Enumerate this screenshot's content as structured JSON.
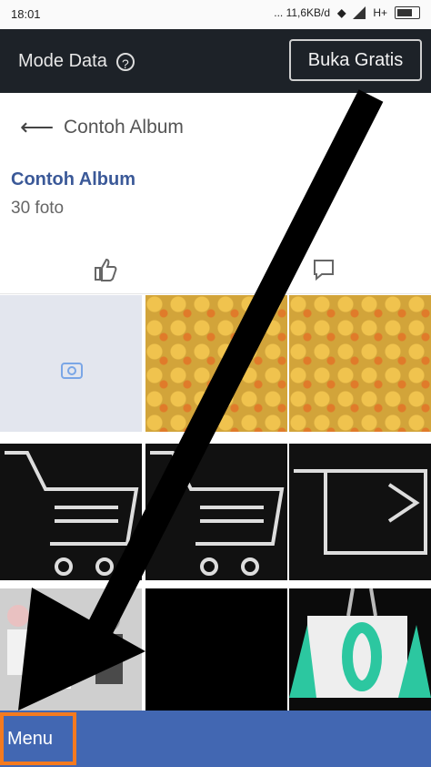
{
  "status_bar": {
    "time": "18:01",
    "network_speed": "... 11,6KB/d",
    "network_type": "H+"
  },
  "data_bar": {
    "mode_label": "Mode Data",
    "help_icon": "question-circle-icon",
    "free_button": "Buka Gratis"
  },
  "header": {
    "back_icon": "arrow-left-icon",
    "title": "Contoh Album"
  },
  "album": {
    "name": "Contoh Album",
    "count": "30 foto"
  },
  "actions": {
    "like_icon": "thumbs-up-icon",
    "comment_icon": "comment-icon"
  },
  "bottom": {
    "menu_label": "Menu"
  },
  "colors": {
    "link_blue": "#3b5998",
    "bar_blue": "#4267b2",
    "dark_bar": "#1d2228",
    "highlight_orange": "#f47a1f"
  }
}
